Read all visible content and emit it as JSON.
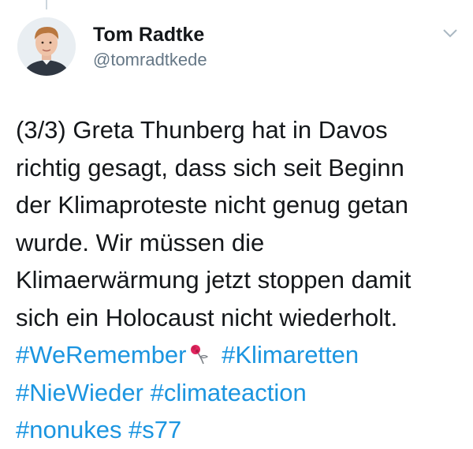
{
  "tweet": {
    "author": {
      "display_name": "Tom Radtke",
      "handle": "@tomradtkede"
    },
    "text_lines": [
      "(3/3) Greta Thunberg hat in Davos",
      "richtig gesagt, dass sich seit Beginn",
      "der Klimaproteste nicht genug getan",
      "wurde. Wir müssen die",
      "Klimaerwärmung jetzt stoppen damit",
      "sich ein Holocaust nicht wiederholt."
    ],
    "hashtags": [
      "#WeRemember",
      "#Klimaretten",
      "#NieWieder",
      "#climateaction"
    ],
    "partial_line": "#nonukes #s77"
  },
  "colors": {
    "link": "#1b95e0",
    "text": "#14171a",
    "secondary": "#657786"
  },
  "icons": {
    "menu": "chevron-down-icon",
    "emoji": "rose-icon"
  }
}
